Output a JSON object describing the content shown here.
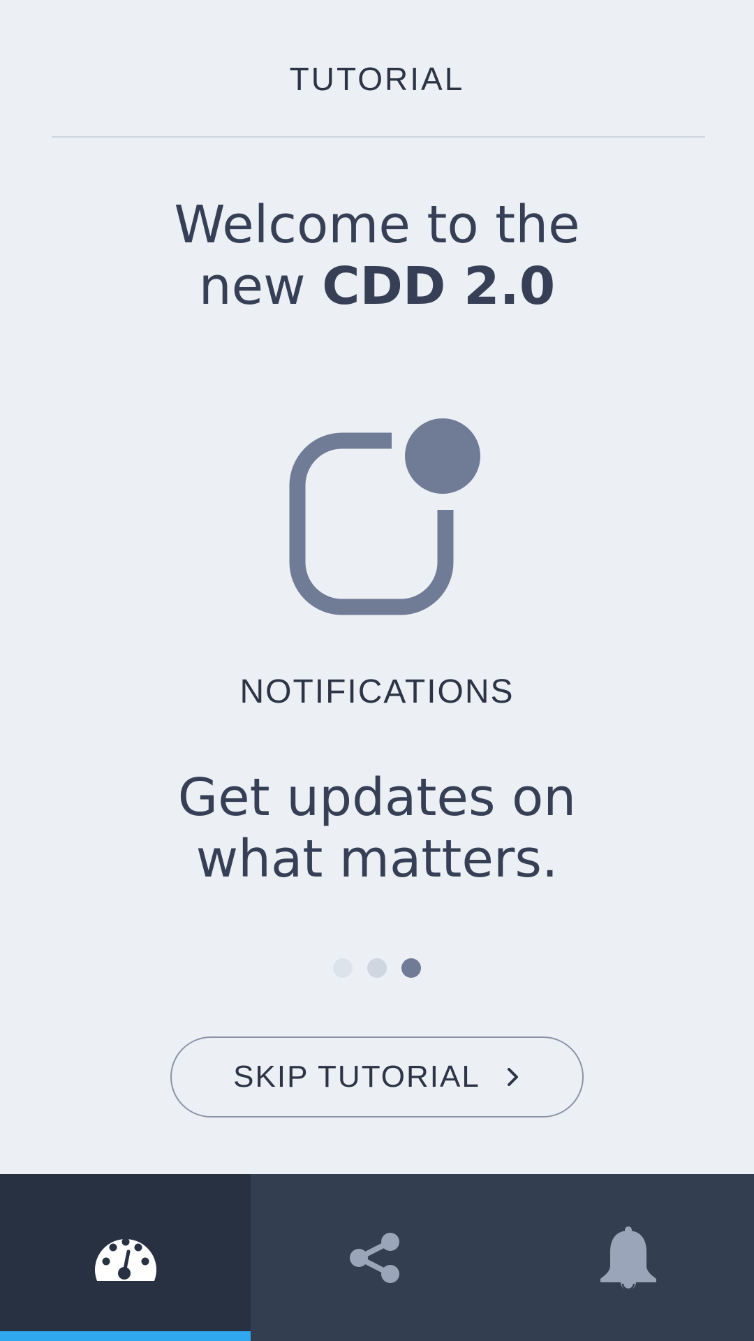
{
  "header": {
    "title": "TUTORIAL"
  },
  "welcome": {
    "line1": "Welcome to the",
    "line2_prefix": "new ",
    "line2_bold": "CDD 2.0"
  },
  "feature": {
    "icon": "notification-badge-icon",
    "title": "NOTIFICATIONS",
    "desc_line1": "Get updates on",
    "desc_line2": "what matters."
  },
  "pager": {
    "total": 3,
    "active_index": 3
  },
  "skip_button": {
    "label": "SKIP TUTORIAL",
    "icon": "chevron-right-icon"
  },
  "tabbar": {
    "active_index": 0,
    "items": [
      {
        "icon": "dashboard-gauge-icon"
      },
      {
        "icon": "share-icon"
      },
      {
        "icon": "bell-icon"
      }
    ]
  },
  "colors": {
    "background": "#ecf0f5",
    "text": "#333d52",
    "icon_gray": "#707c96",
    "tabbar": "#343e51",
    "tabbar_active": "#283142",
    "accent": "#2fa8f0"
  }
}
